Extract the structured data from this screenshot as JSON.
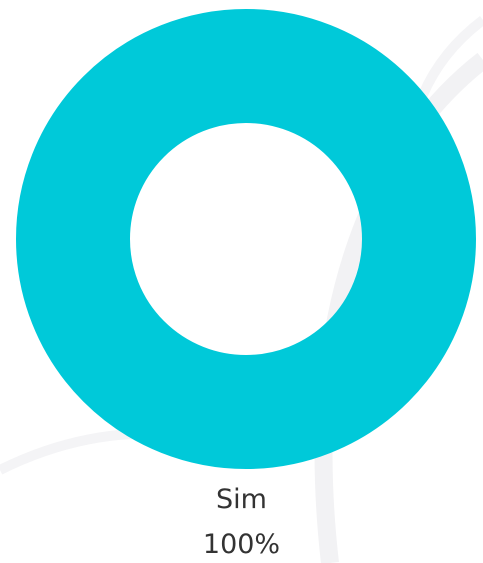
{
  "chart_data": {
    "type": "pie",
    "variant": "donut",
    "categories": [
      "Sim"
    ],
    "values": [
      100
    ],
    "value_labels": [
      "100%"
    ],
    "colors": [
      "#00c9d9"
    ]
  },
  "colors": {
    "background": "#ffffff",
    "swoosh": "#f2f2f4",
    "label_text": "#333333"
  }
}
